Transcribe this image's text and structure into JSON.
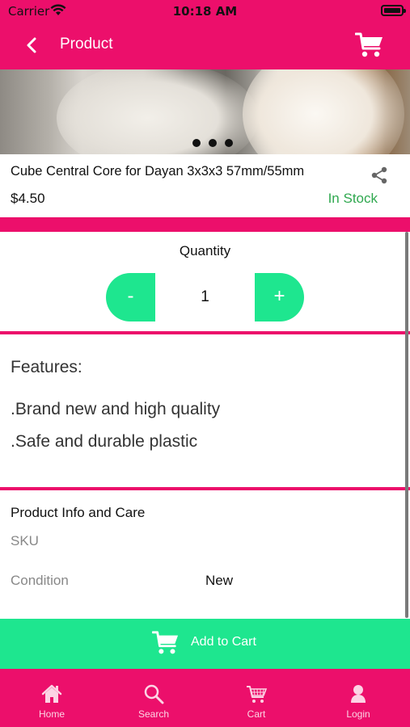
{
  "status_bar": {
    "carrier": "Carrier",
    "time": "10:18 AM"
  },
  "nav": {
    "title": "Product",
    "back_icon": "chevron-left-icon",
    "cart_icon": "cart-icon"
  },
  "colors": {
    "brand_pink": "#ec0f6b",
    "accent_green": "#1ee68f",
    "stock_green": "#2fa84f"
  },
  "product": {
    "name": "Cube Central Core for Dayan 3x3x3 57mm/55mm",
    "price": "$4.50",
    "stock_status": "In Stock",
    "share_icon": "share-icon"
  },
  "quantity": {
    "label": "Quantity",
    "minus_label": "-",
    "value": "1",
    "plus_label": "+"
  },
  "features": {
    "heading": "Features:",
    "items": [
      ".Brand new and high quality",
      ".Safe and durable plastic"
    ]
  },
  "care": {
    "heading": "Product Info and Care",
    "sku_label": "SKU",
    "condition_label": "Condition",
    "condition_value": "New"
  },
  "add_to_cart": {
    "label": "Add to Cart"
  },
  "tabs": [
    {
      "label": "Home",
      "icon": "home-icon"
    },
    {
      "label": "Search",
      "icon": "search-icon"
    },
    {
      "label": "Cart",
      "icon": "cart-icon"
    },
    {
      "label": "Login",
      "icon": "user-icon"
    }
  ]
}
